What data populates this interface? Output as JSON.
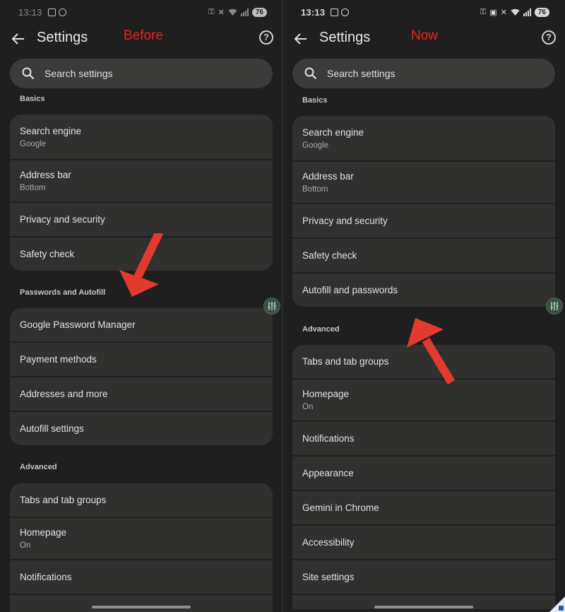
{
  "left": {
    "time": "13:13",
    "battery": "76",
    "title": "Settings",
    "overlay_label": "Before",
    "search_placeholder": "Search settings",
    "sections": {
      "basics": "Basics",
      "passwords": "Passwords and Autofill",
      "advanced": "Advanced"
    },
    "basics_items": [
      {
        "label": "Search engine",
        "sub": "Google"
      },
      {
        "label": "Address bar",
        "sub": "Bottom"
      },
      {
        "label": "Privacy and security"
      },
      {
        "label": "Safety check"
      }
    ],
    "passwords_items": [
      {
        "label": "Google Password Manager"
      },
      {
        "label": "Payment methods"
      },
      {
        "label": "Addresses and more"
      },
      {
        "label": "Autofill settings"
      }
    ],
    "advanced_items": [
      {
        "label": "Tabs and tab groups"
      },
      {
        "label": "Homepage",
        "sub": "On"
      },
      {
        "label": "Notifications"
      }
    ]
  },
  "right": {
    "time": "13:13",
    "battery": "76",
    "title": "Settings",
    "overlay_label": "Now",
    "search_placeholder": "Search settings",
    "sections": {
      "basics": "Basics",
      "advanced": "Advanced"
    },
    "basics_items": [
      {
        "label": "Search engine",
        "sub": "Google"
      },
      {
        "label": "Address bar",
        "sub": "Bottom"
      },
      {
        "label": "Privacy and security"
      },
      {
        "label": "Safety check"
      },
      {
        "label": "Autofill and passwords"
      }
    ],
    "advanced_items": [
      {
        "label": "Tabs and tab groups"
      },
      {
        "label": "Homepage",
        "sub": "On"
      },
      {
        "label": "Notifications"
      },
      {
        "label": "Appearance"
      },
      {
        "label": "Gemini in Chrome"
      },
      {
        "label": "Accessibility"
      },
      {
        "label": "Site settings"
      }
    ]
  },
  "colors": {
    "background": "#1e1f1e",
    "card": "#30312f",
    "search": "#3b3c3a",
    "annotation_red": "#e8231f"
  },
  "icons": [
    "back-arrow-icon",
    "help-icon",
    "search-icon",
    "adjust-icon",
    "wifi-icon",
    "signal-icon",
    "key-icon",
    "mute-icon"
  ]
}
